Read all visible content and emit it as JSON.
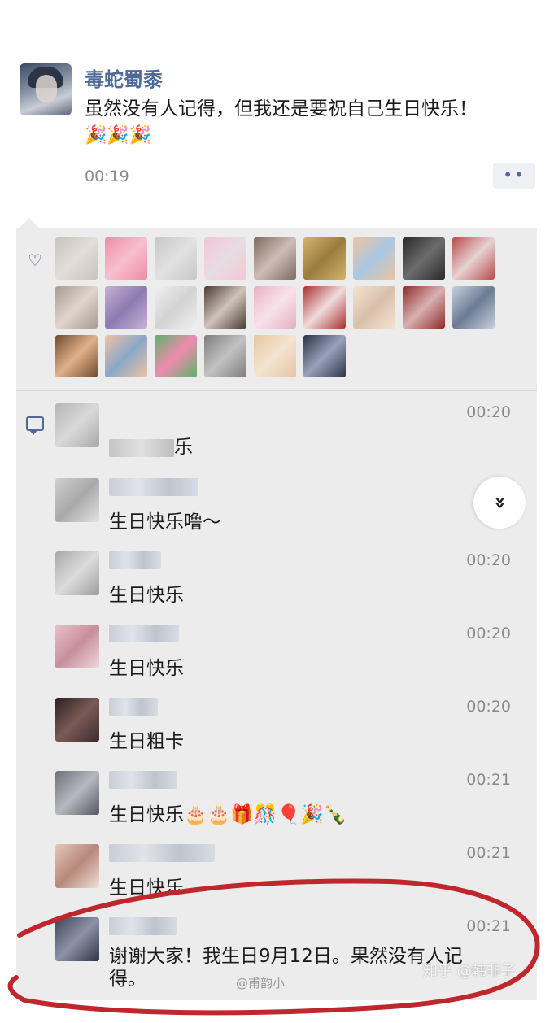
{
  "post": {
    "author": "毒蛇蜀黍",
    "text": "虽然没有人记得，但我还是要祝自己生日快乐！",
    "emoji": "🎉🎉🎉",
    "time": "00:19",
    "more_label": "••"
  },
  "likes": {
    "icon": "heart-outline-icon",
    "count_visible": 25
  },
  "comments": [
    {
      "text": "乐",
      "time": "00:20",
      "text_blurred_prefix": true
    },
    {
      "text": "生日快乐噜～",
      "time": "00:20"
    },
    {
      "text": "生日快乐",
      "time": "00:20"
    },
    {
      "text": "生日快乐",
      "time": "00:20"
    },
    {
      "text": "生日粗卡",
      "time": "00:20"
    },
    {
      "text": "生日快乐🎂🎂🎁🎊🎈🎉🍾",
      "time": "00:21"
    },
    {
      "text": "生日快乐",
      "time": "00:21"
    },
    {
      "text": "谢谢大家！我生日9月12日。果然没有人记",
      "text_line2": "得。",
      "time": "00:21"
    }
  ],
  "scroll_button": {
    "icon": "double-chevron-down-icon",
    "glyph": "»"
  },
  "watermarks": {
    "right": "知乎 @韩非子",
    "center": "@甫韵小"
  },
  "colors": {
    "author_blue": "#4f6a99",
    "panel_bg": "#ececec",
    "time_gray": "#8a8a8a",
    "annotation_red": "#c0272d"
  }
}
